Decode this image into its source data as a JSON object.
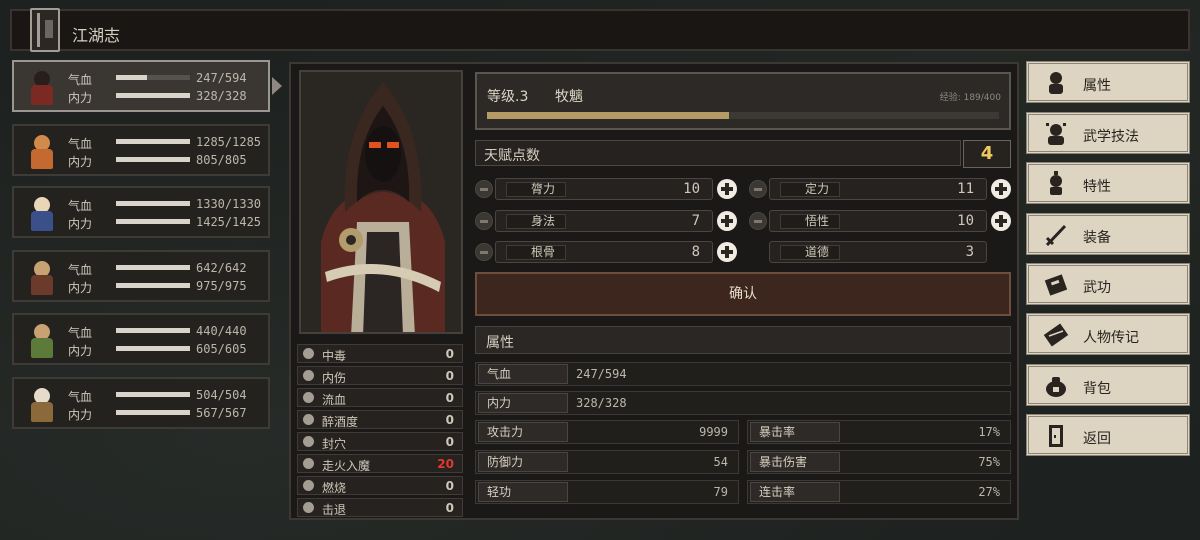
{
  "window": {
    "title": "江湖志"
  },
  "roster": [
    {
      "hp_label": "气血",
      "mp_label": "内力",
      "hp": "247/594",
      "mp": "328/328",
      "hp_frac": 0.416,
      "mp_frac": 1.0
    },
    {
      "hp_label": "气血",
      "mp_label": "内力",
      "hp": "1285/1285",
      "mp": "805/805",
      "hp_frac": 1.0,
      "mp_frac": 1.0
    },
    {
      "hp_label": "气血",
      "mp_label": "内力",
      "hp": "1330/1330",
      "mp": "1425/1425",
      "hp_frac": 1.0,
      "mp_frac": 1.0
    },
    {
      "hp_label": "气血",
      "mp_label": "内力",
      "hp": "642/642",
      "mp": "975/975",
      "hp_frac": 1.0,
      "mp_frac": 1.0
    },
    {
      "hp_label": "气血",
      "mp_label": "内力",
      "hp": "440/440",
      "mp": "605/605",
      "hp_frac": 1.0,
      "mp_frac": 1.0
    },
    {
      "hp_label": "气血",
      "mp_label": "内力",
      "hp": "504/504",
      "mp": "567/567",
      "hp_frac": 1.0,
      "mp_frac": 1.0
    }
  ],
  "statuses": [
    {
      "name": "中毒",
      "value": "0"
    },
    {
      "name": "内伤",
      "value": "0"
    },
    {
      "name": "流血",
      "value": "0"
    },
    {
      "name": "醉酒度",
      "value": "0"
    },
    {
      "name": "封穴",
      "value": "0"
    },
    {
      "name": "走火入魔",
      "value": "20"
    },
    {
      "name": "燃烧",
      "value": "0"
    },
    {
      "name": "击退",
      "value": "0"
    }
  ],
  "level": {
    "text": "等级.3",
    "name": "牧魑",
    "exp": "经验: 189/400",
    "exp_frac": 0.4725
  },
  "talent": {
    "label": "天赋点数",
    "points": "4"
  },
  "attributes": {
    "left": [
      {
        "name": "膂力",
        "value": "10"
      },
      {
        "name": "身法",
        "value": "7"
      },
      {
        "name": "根骨",
        "value": "8"
      }
    ],
    "right": [
      {
        "name": "定力",
        "value": "11"
      },
      {
        "name": "悟性",
        "value": "10"
      },
      {
        "name": "道德",
        "value": "3"
      }
    ]
  },
  "confirm_label": "确认",
  "props": {
    "header": "属性",
    "hp_label": "气血",
    "hp_value": "247/594",
    "mp_label": "内力",
    "mp_value": "328/328",
    "rows": [
      {
        "k1": "攻击力",
        "v1": "9999",
        "k2": "暴击率",
        "v2": "17%"
      },
      {
        "k1": "防御力",
        "v1": "54",
        "k2": "暴击伤害",
        "v2": "75%"
      },
      {
        "k1": "轻功",
        "v1": "79",
        "k2": "连击率",
        "v2": "27%"
      }
    ]
  },
  "menu": [
    {
      "label": "属性",
      "icon": "person-icon"
    },
    {
      "label": "武学技法",
      "icon": "skills-icon"
    },
    {
      "label": "特性",
      "icon": "trait-icon"
    },
    {
      "label": "装备",
      "icon": "sword-icon"
    },
    {
      "label": "武功",
      "icon": "manual-icon"
    },
    {
      "label": "人物传记",
      "icon": "scroll-icon"
    },
    {
      "label": "背包",
      "icon": "bag-icon"
    },
    {
      "label": "返回",
      "icon": "door-icon"
    }
  ],
  "colors": {
    "accent_gold": "#f1c95e",
    "danger": "#e03a2e",
    "confirm_bg": "#3c261d"
  }
}
